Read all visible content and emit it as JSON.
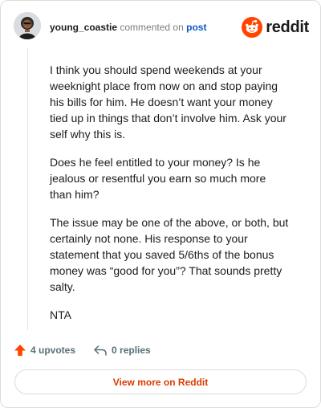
{
  "header": {
    "username": "young_coastie",
    "action_text": "commented on",
    "post_link": "post",
    "brand": "reddit"
  },
  "comment": {
    "paragraphs": [
      "I think you should spend weekends at your weeknight place from now on and stop paying his bills for him. He doesn’t want your money tied up in things that don’t involve him. Ask your self why this is.",
      "Does he feel entitled to your money? Is he jealous or resentful you earn so much more than him?",
      "The issue may be one of the above, or both, but certainly not none. His response to your statement that you saved 5/6ths of the bonus money was “good for you”? That sounds pretty salty.",
      "NTA"
    ]
  },
  "actions": {
    "upvotes": "4 upvotes",
    "replies": "0 replies"
  },
  "footer": {
    "view_more": "View more on Reddit"
  },
  "colors": {
    "brand_orange": "#ff4500",
    "link_blue": "#0a58ca",
    "cta_text": "#d93a00"
  },
  "icons": {
    "brand": "reddit-alien-icon",
    "upvote": "upvote-arrow-icon",
    "reply": "reply-arrow-icon"
  }
}
